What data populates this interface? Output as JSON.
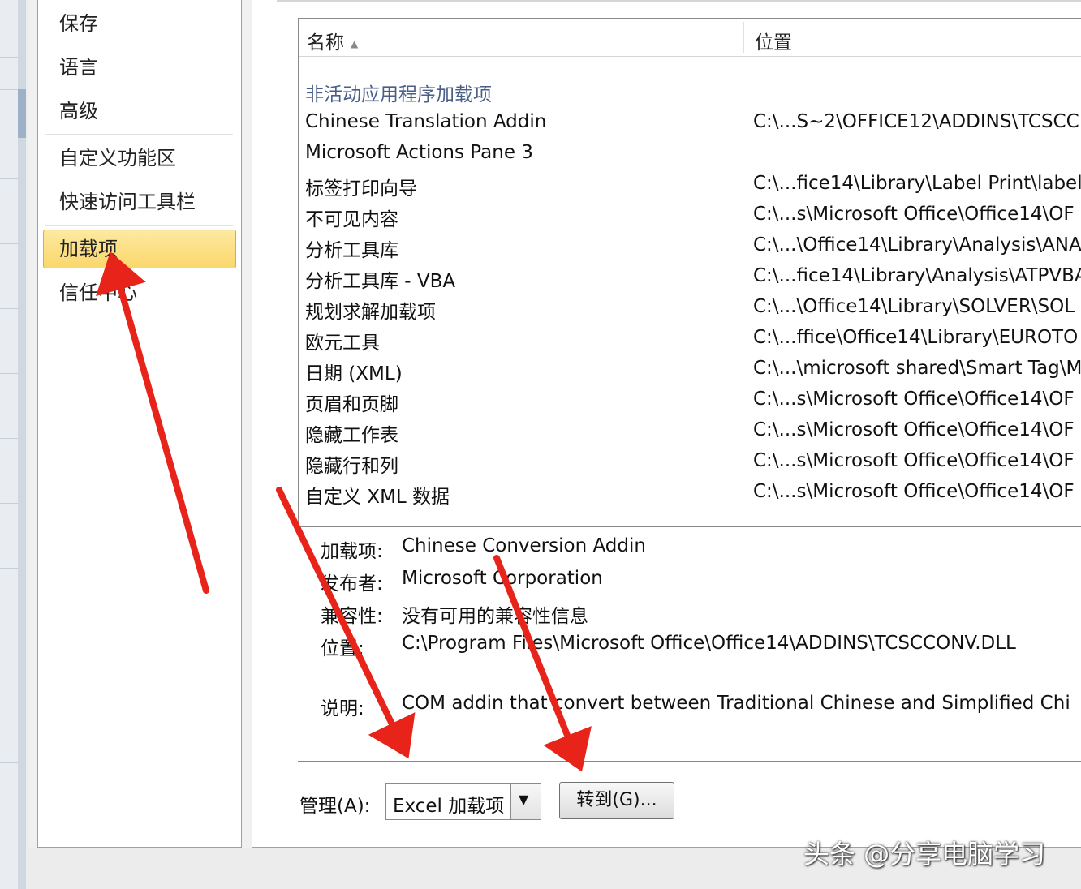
{
  "nav": {
    "items": [
      {
        "label": "保存"
      },
      {
        "label": "语言"
      },
      {
        "label": "高级"
      },
      {
        "label": "自定义功能区"
      },
      {
        "label": "快速访问工具栏"
      },
      {
        "label": "加载项",
        "selected": true
      },
      {
        "label": "信任中心"
      }
    ]
  },
  "list": {
    "headers": {
      "name": "名称",
      "location": "位置"
    },
    "group_title": "非活动应用程序加载项",
    "rows": [
      {
        "name": "Chinese Translation Addin",
        "location": "C:\\...S~2\\OFFICE12\\ADDINS\\TCSCC"
      },
      {
        "name": "Microsoft Actions Pane 3",
        "location": ""
      },
      {
        "name": "标签打印向导",
        "location": "C:\\...fice14\\Library\\Label Print\\label"
      },
      {
        "name": "不可见内容",
        "location": "C:\\...s\\Microsoft Office\\Office14\\OF"
      },
      {
        "name": "分析工具库",
        "location": "C:\\...\\Office14\\Library\\Analysis\\ANA"
      },
      {
        "name": "分析工具库 - VBA",
        "location": "C:\\...fice14\\Library\\Analysis\\ATPVBA"
      },
      {
        "name": "规划求解加载项",
        "location": "C:\\...\\Office14\\Library\\SOLVER\\SOL"
      },
      {
        "name": "欧元工具",
        "location": "C:\\...ffice\\Office14\\Library\\EUROTO"
      },
      {
        "name": "日期 (XML)",
        "location": "C:\\...\\microsoft shared\\Smart Tag\\M"
      },
      {
        "name": "页眉和页脚",
        "location": "C:\\...s\\Microsoft Office\\Office14\\OF"
      },
      {
        "name": "隐藏工作表",
        "location": "C:\\...s\\Microsoft Office\\Office14\\OF"
      },
      {
        "name": "隐藏行和列",
        "location": "C:\\...s\\Microsoft Office\\Office14\\OF"
      },
      {
        "name": "自定义 XML 数据",
        "location": "C:\\...s\\Microsoft Office\\Office14\\OF"
      }
    ]
  },
  "details": {
    "addin_label": "加载项:",
    "addin_value": "Chinese Conversion Addin",
    "publisher_label": "发布者:",
    "publisher_value": "Microsoft Corporation",
    "compat_label": "兼容性:",
    "compat_value": "没有可用的兼容性信息",
    "location_label": "位置:",
    "location_value": "C:\\Program Files\\Microsoft Office\\Office14\\ADDINS\\TCSCCONV.DLL",
    "desc_label": "说明:",
    "desc_value": "COM addin that convert between Traditional Chinese and Simplified Chi"
  },
  "manage": {
    "label": "管理(A):",
    "selected": "Excel 加载项",
    "go_label": "转到(G)..."
  },
  "watermark": "头条 @分享电脑学习",
  "colors": {
    "selection": "#fbd76c",
    "arrow": "#e8231a",
    "group_title": "#4a5f88"
  }
}
